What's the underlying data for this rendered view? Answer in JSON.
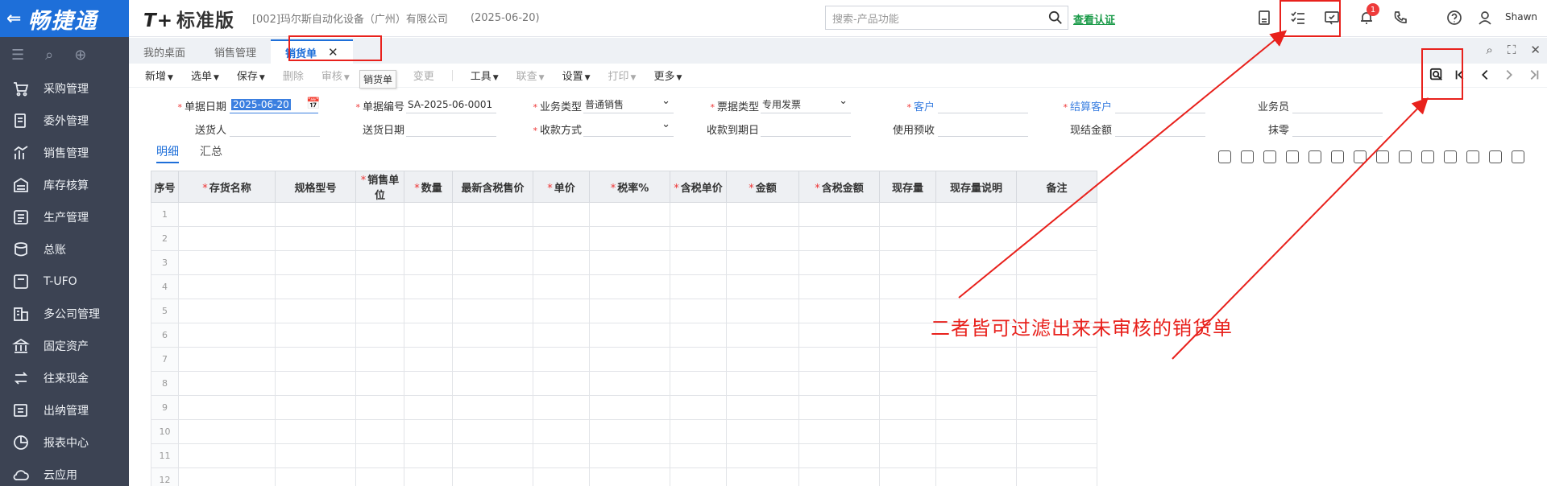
{
  "app": {
    "logo_text": "畅捷通",
    "brand": "标准版",
    "brand_prefix": "T+",
    "company": "[002]玛尔斯自动化设备（广州）有限公司",
    "date": "(2025-06-20)",
    "search_placeholder": "搜索-产品功能",
    "verify_link": "查看认证",
    "notification_count": "1",
    "user_name": "Shawn"
  },
  "sidebar": {
    "items": [
      {
        "label": "采购管理",
        "icon": "cart-icon"
      },
      {
        "label": "委外管理",
        "icon": "outsource-icon"
      },
      {
        "label": "销售管理",
        "icon": "sales-chart-icon"
      },
      {
        "label": "库存核算",
        "icon": "warehouse-icon"
      },
      {
        "label": "生产管理",
        "icon": "production-icon"
      },
      {
        "label": "总账",
        "icon": "ledger-icon"
      },
      {
        "label": "T-UFO",
        "icon": "ufo-icon"
      },
      {
        "label": "多公司管理",
        "icon": "multi-company-icon"
      },
      {
        "label": "固定资产",
        "icon": "asset-icon"
      },
      {
        "label": "往来现金",
        "icon": "exchange-icon"
      },
      {
        "label": "出纳管理",
        "icon": "cashier-icon"
      },
      {
        "label": "报表中心",
        "icon": "pie-icon"
      },
      {
        "label": "云应用",
        "icon": "cloud-icon"
      }
    ]
  },
  "tabs": [
    {
      "label": "我的桌面"
    },
    {
      "label": "销售管理"
    },
    {
      "label": "销货单",
      "active": true
    }
  ],
  "toolbar": {
    "items": [
      {
        "label": "新增",
        "caret": true,
        "disabled": false
      },
      {
        "label": "选单",
        "caret": true,
        "disabled": false
      },
      {
        "label": "保存",
        "caret": true,
        "disabled": false
      },
      {
        "label": "删除",
        "caret": false,
        "disabled": true
      },
      {
        "label": "审核",
        "caret": true,
        "disabled": true
      },
      {
        "label": "转换",
        "caret": true,
        "disabled": true
      },
      {
        "label": "变更",
        "caret": false,
        "disabled": true
      },
      {
        "label": "工具",
        "caret": true,
        "disabled": false
      },
      {
        "label": "联查",
        "caret": true,
        "disabled": true
      },
      {
        "label": "设置",
        "caret": true,
        "disabled": false
      },
      {
        "label": "打印",
        "caret": true,
        "disabled": true
      },
      {
        "label": "更多",
        "caret": true,
        "disabled": false
      }
    ],
    "tooltip": "销货单"
  },
  "form": {
    "doc_date_label": "单据日期",
    "doc_date": "2025-06-20",
    "doc_no_label": "单据编号",
    "doc_no": "SA-2025-06-0001",
    "biz_type_label": "业务类型",
    "biz_type": "普通销售",
    "invoice_type_label": "票据类型",
    "invoice_type": "专用发票",
    "customer_label": "客户",
    "settle_customer_label": "结算客户",
    "salesman_label": "业务员",
    "deliverer_label": "送货人",
    "delivery_date_label": "送货日期",
    "payment_method_label": "收款方式",
    "due_date_label": "收款到期日",
    "prepay_label": "使用预收",
    "cash_amount_label": "现结金额",
    "rounding_label": "抹零"
  },
  "detail_tabs": [
    {
      "label": "明细",
      "active": true
    },
    {
      "label": "汇总",
      "active": false
    }
  ],
  "grid": {
    "columns": [
      {
        "label": "序号",
        "required": false
      },
      {
        "label": "存货名称",
        "required": true
      },
      {
        "label": "规格型号",
        "required": false
      },
      {
        "label": "销售单位",
        "required": true
      },
      {
        "label": "数量",
        "required": true
      },
      {
        "label": "最新含税售价",
        "required": false
      },
      {
        "label": "单价",
        "required": true
      },
      {
        "label": "税率%",
        "required": true
      },
      {
        "label": "含税单价",
        "required": true
      },
      {
        "label": "金额",
        "required": true
      },
      {
        "label": "含税金额",
        "required": true
      },
      {
        "label": "现存量",
        "required": false
      },
      {
        "label": "现存量说明",
        "required": false
      },
      {
        "label": "备注",
        "required": false
      }
    ],
    "row_numbers": [
      "1",
      "2",
      "3",
      "4",
      "5",
      "6",
      "7",
      "8",
      "9",
      "10",
      "11",
      "12"
    ]
  },
  "annotation": {
    "text": "二者皆可过滤出来未审核的销货单",
    "color": "#e8211c"
  },
  "colors": {
    "sidebar_bg": "#3c4353",
    "brand_blue": "#1e6fd9",
    "verify_green": "#1a9a48"
  }
}
